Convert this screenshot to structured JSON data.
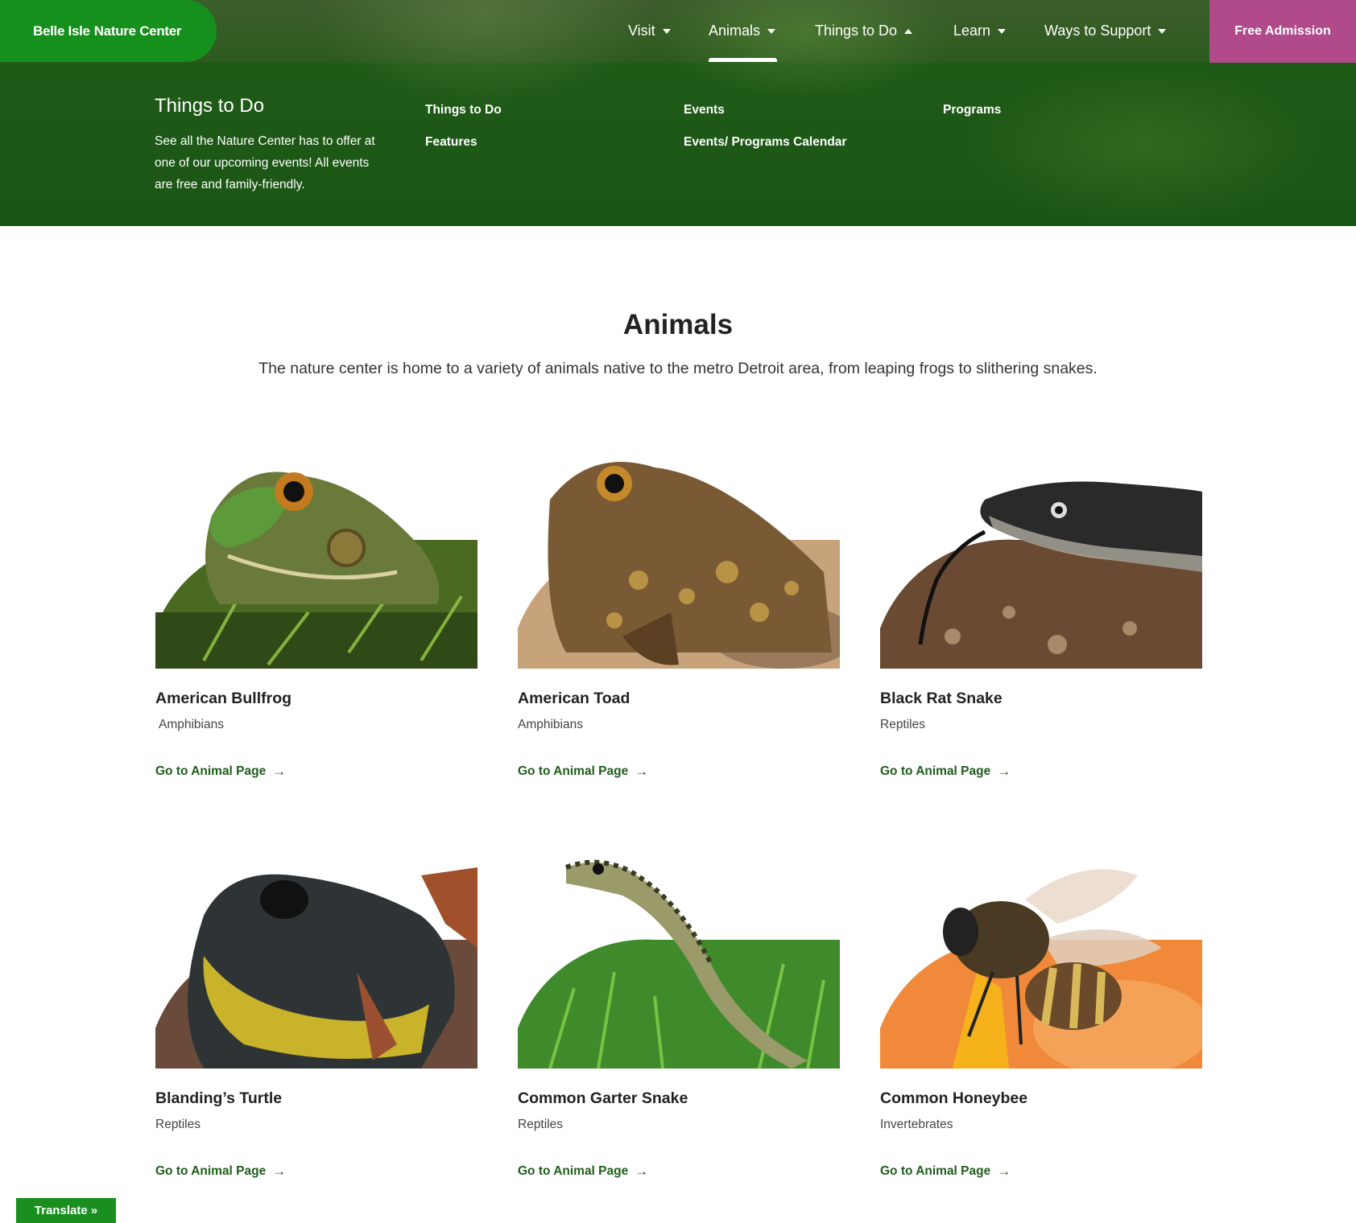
{
  "header": {
    "logo_text_light": "Belle Isle",
    "logo_text_bold": "Nature Center",
    "nav": [
      {
        "label": "Visit",
        "caret": "down"
      },
      {
        "label": "Animals",
        "caret": "down",
        "active": true
      },
      {
        "label": "Things to Do",
        "caret": "up",
        "open": true
      },
      {
        "label": "Learn",
        "caret": "down"
      },
      {
        "label": "Ways to Support",
        "caret": "down"
      }
    ],
    "cta_label": "Free Admission",
    "colors": {
      "logo_bg": "#16901c",
      "cta_bg": "#b04a8a",
      "menu_bg": "#1f5a17"
    }
  },
  "mega_menu": {
    "title": "Things to Do",
    "description": "See all the Nature Center has to offer at one of our upcoming events! All events are free and family-friendly.",
    "links": [
      "Things to Do",
      "Features",
      "Events",
      "Events/ Programs Calendar",
      "Programs"
    ]
  },
  "main": {
    "title": "Animals",
    "intro": "The nature center is home to a variety of animals native to the metro Detroit area, from leaping frogs to slithering snakes.",
    "link_label": "Go to Animal Page",
    "animals": [
      {
        "name": "American Bullfrog",
        "category": "Amphibians",
        "image_icon": "bullfrog-photo"
      },
      {
        "name": "American Toad",
        "category": "Amphibians",
        "image_icon": "toad-photo"
      },
      {
        "name": "Black Rat Snake",
        "category": "Reptiles",
        "image_icon": "rat-snake-photo"
      },
      {
        "name": "Blanding’s Turtle",
        "category": "Reptiles",
        "image_icon": "turtle-photo"
      },
      {
        "name": "Common Garter Snake",
        "category": "Reptiles",
        "image_icon": "garter-snake-photo"
      },
      {
        "name": "Common Honeybee",
        "category": "Invertebrates",
        "image_icon": "honeybee-photo"
      }
    ]
  },
  "translate_label": "Translate »"
}
